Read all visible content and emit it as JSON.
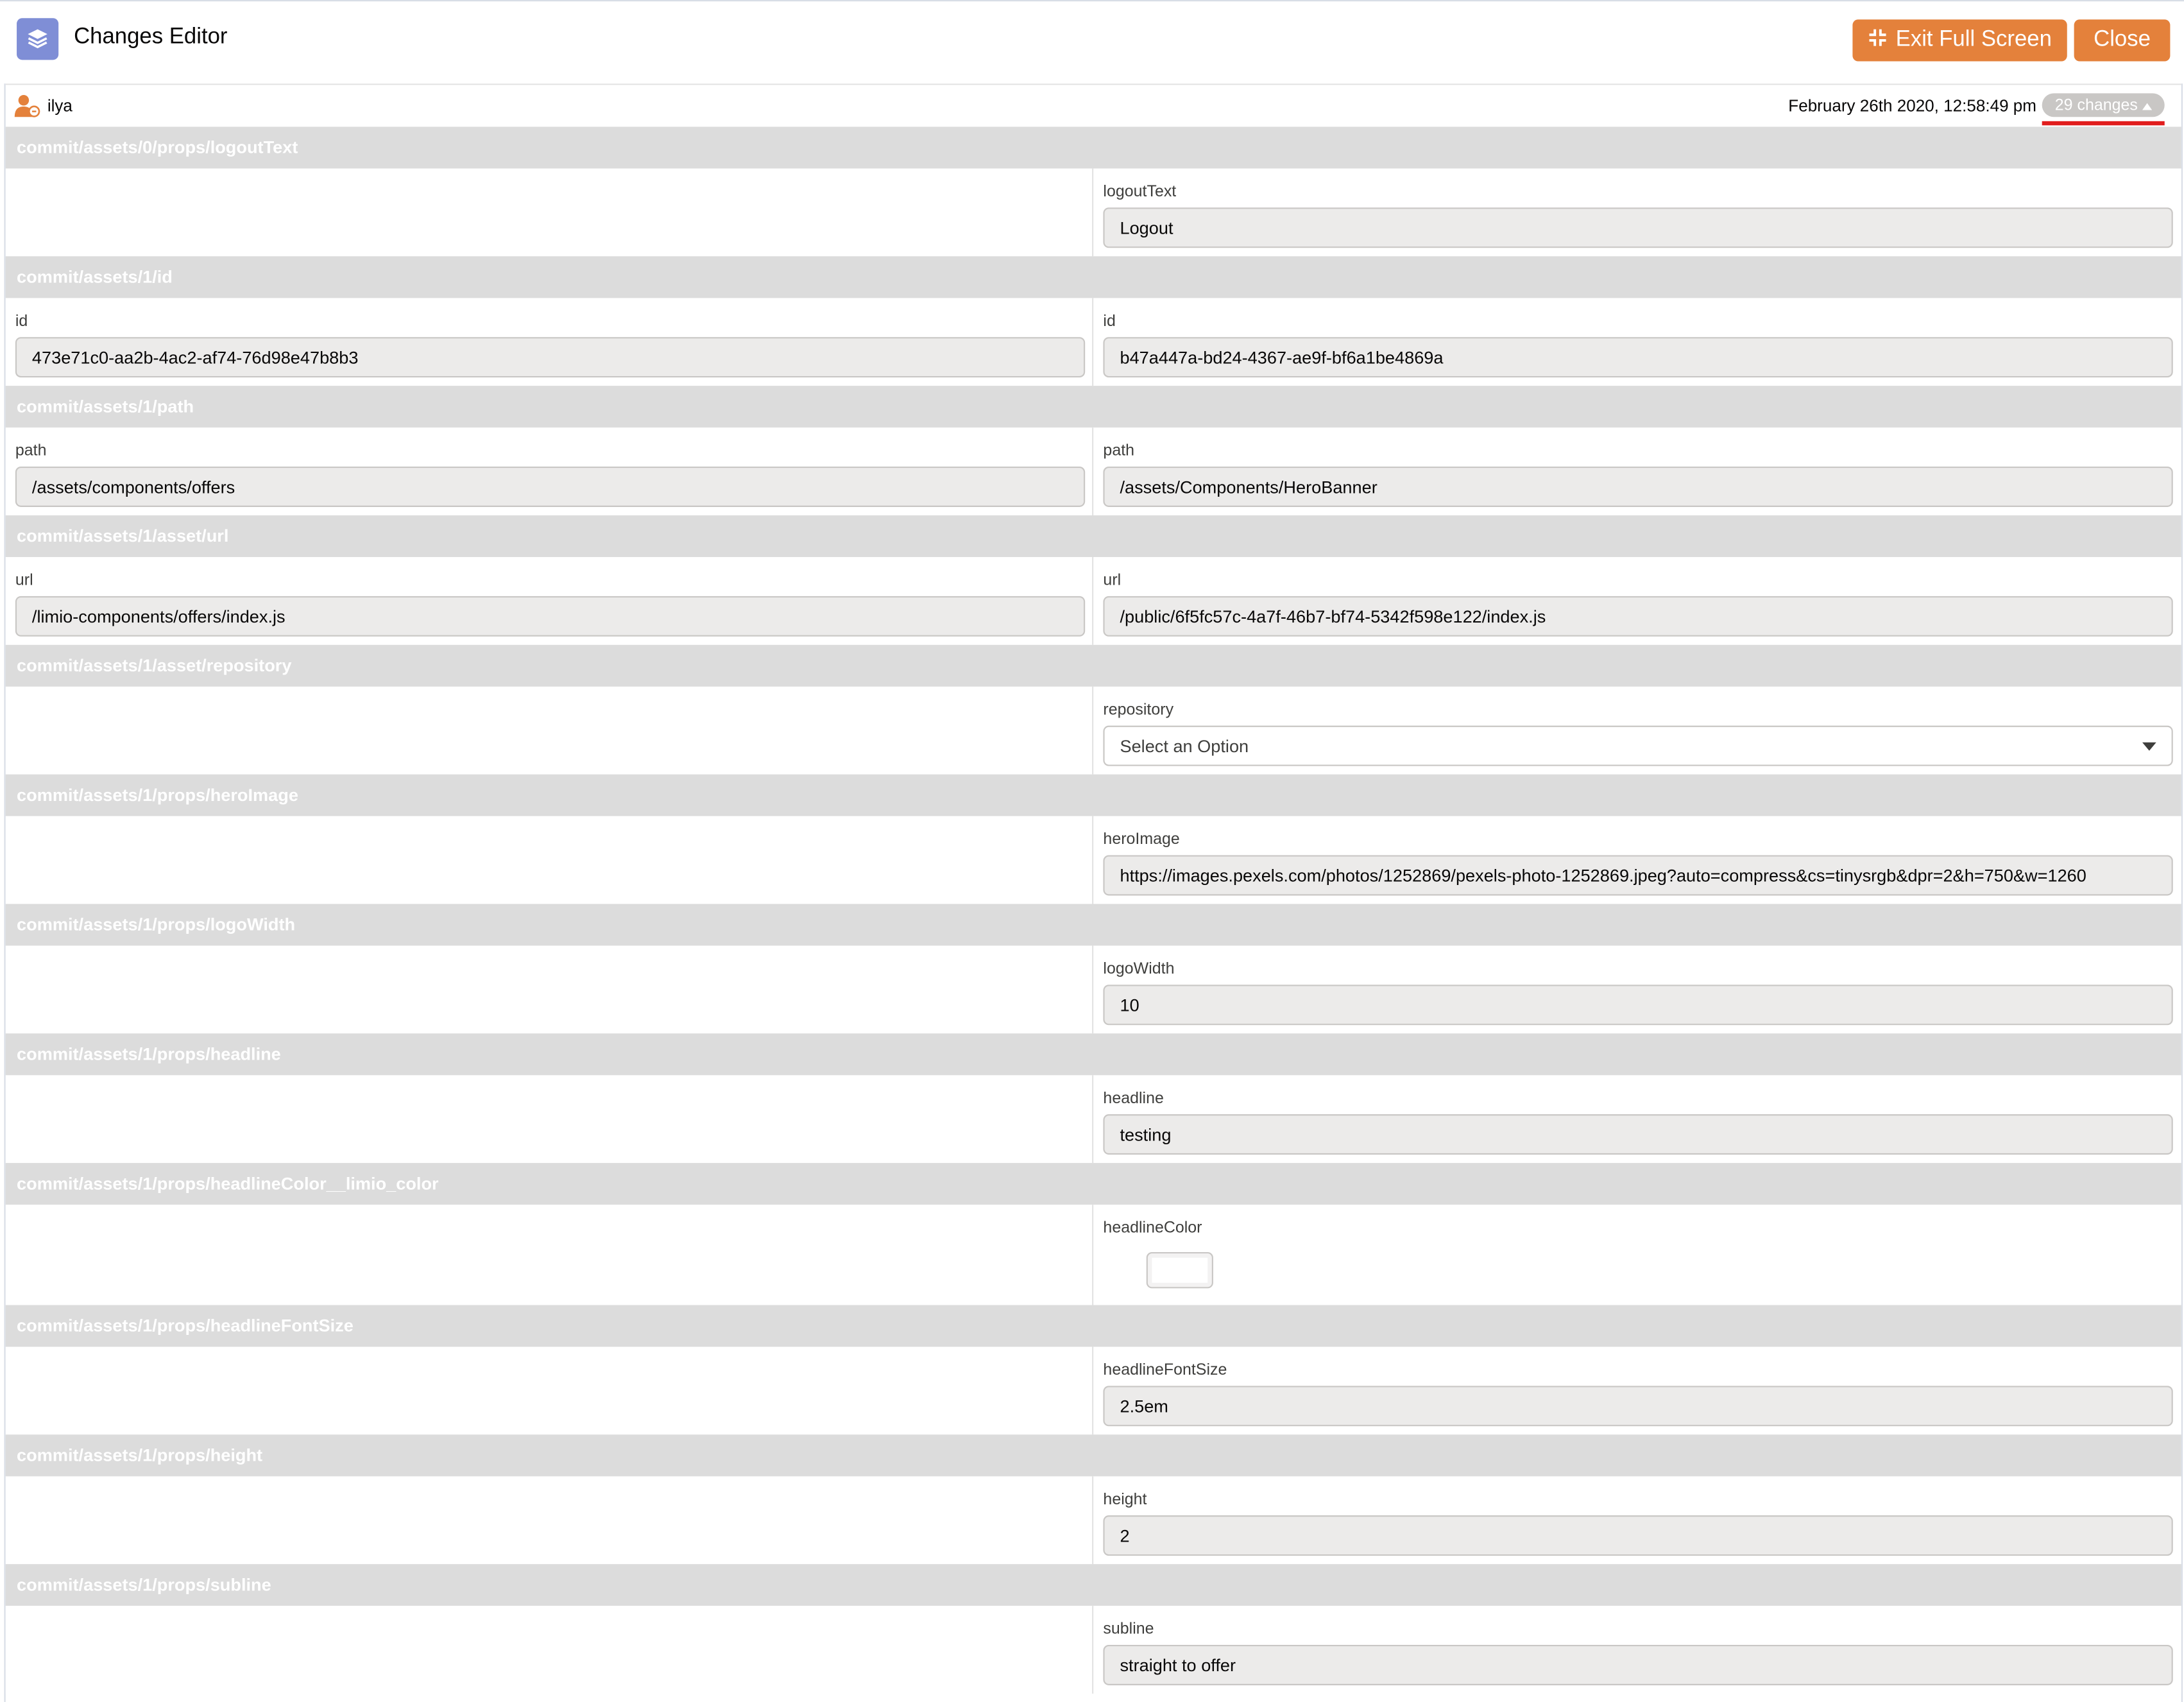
{
  "header": {
    "title": "Changes Editor",
    "exit_fullscreen_label": "Exit Full Screen",
    "close_label": "Close",
    "accent_color": "#e4813b",
    "app_icon": "stack-layers-icon"
  },
  "info": {
    "user": "ilya",
    "timestamp": "February 26th 2020, 12:58:49 pm",
    "changes_count": "29 changes"
  },
  "sections": [
    {
      "path": "commit/assets/0/props/logoutText",
      "left": null,
      "right": {
        "label": "logoutText",
        "value": "Logout"
      }
    },
    {
      "path": "commit/assets/1/id",
      "left": {
        "label": "id",
        "value": "473e71c0-aa2b-4ac2-af74-76d98e47b8b3"
      },
      "right": {
        "label": "id",
        "value": "b47a447a-bd24-4367-ae9f-bf6a1be4869a"
      }
    },
    {
      "path": "commit/assets/1/path",
      "left": {
        "label": "path",
        "value": "/assets/components/offers"
      },
      "right": {
        "label": "path",
        "value": "/assets/Components/HeroBanner"
      }
    },
    {
      "path": "commit/assets/1/asset/url",
      "left": {
        "label": "url",
        "value": "/limio-components/offers/index.js"
      },
      "right": {
        "label": "url",
        "value": "/public/6f5fc57c-4a7f-46b7-bf74-5342f598e122/index.js"
      }
    },
    {
      "path": "commit/assets/1/asset/repository",
      "left": null,
      "right": {
        "label": "repository",
        "type": "select",
        "value": "Select an Option"
      }
    },
    {
      "path": "commit/assets/1/props/heroImage",
      "left": null,
      "right": {
        "label": "heroImage",
        "value": "https://images.pexels.com/photos/1252869/pexels-photo-1252869.jpeg?auto=compress&cs=tinysrgb&dpr=2&h=750&w=1260"
      }
    },
    {
      "path": "commit/assets/1/props/logoWidth",
      "left": null,
      "right": {
        "label": "logoWidth",
        "value": "10"
      }
    },
    {
      "path": "commit/assets/1/props/headline",
      "left": null,
      "right": {
        "label": "headline",
        "value": "testing"
      }
    },
    {
      "path": "commit/assets/1/props/headlineColor__limio_color",
      "left": null,
      "right": {
        "label": "headlineColor",
        "type": "color",
        "value": "#ffffff"
      }
    },
    {
      "path": "commit/assets/1/props/headlineFontSize",
      "left": null,
      "right": {
        "label": "headlineFontSize",
        "value": "2.5em"
      }
    },
    {
      "path": "commit/assets/1/props/height",
      "left": null,
      "right": {
        "label": "height",
        "value": "2"
      }
    },
    {
      "path": "commit/assets/1/props/subline",
      "left": null,
      "right": {
        "label": "subline",
        "value": "straight to offer"
      }
    }
  ]
}
